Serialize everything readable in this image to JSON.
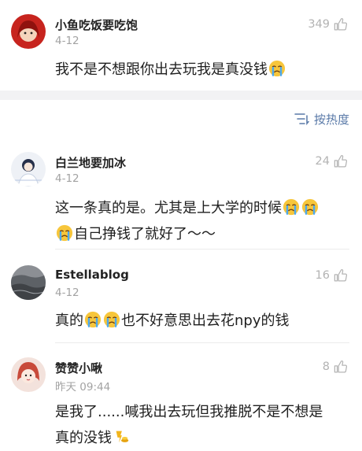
{
  "sort": {
    "label": "按热度"
  },
  "comments": [
    {
      "name": "小鱼吃饭要吃饱",
      "date": "4-12",
      "likes": "349",
      "line1": "我不是不想跟你出去玩我是真没钱"
    },
    {
      "name": "白兰地要加冰",
      "date": "4-12",
      "likes": "24",
      "line1": "这一条真的是。尤其是上大学的时候",
      "line2": "自己挣钱了就好了～～"
    },
    {
      "name": "Estellablog",
      "date": "4-12",
      "likes": "16",
      "line1a": "真的",
      "line1b": "也不好意思出去花npy的钱"
    },
    {
      "name": "赞赞小啾",
      "date": "昨天 09:44",
      "likes": "8",
      "line1": "是我了......喊我出去玩但我推脱不是不想是",
      "line2": "真的没钱"
    }
  ],
  "icons": {
    "like": "thumb-up-icon",
    "sort": "sort-icon",
    "cry": "crying-face-emoji",
    "coin": "coin-pouring-emoji"
  }
}
